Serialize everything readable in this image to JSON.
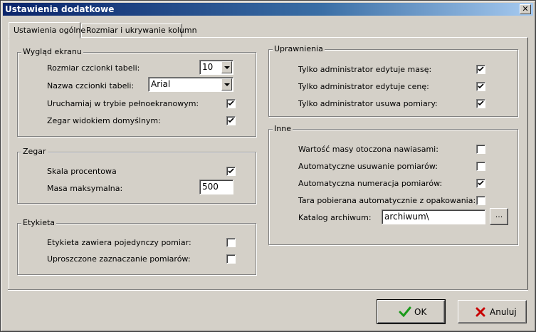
{
  "window": {
    "title": "Ustawienia dodatkowe",
    "close_glyph": "✕"
  },
  "tabs": [
    {
      "label": "Ustawienia ogólne",
      "active": true
    },
    {
      "label": "Rozmiar i ukrywanie kolumn",
      "active": false
    }
  ],
  "screen_group": {
    "title": "Wygląd ekranu",
    "font_size_label": "Rozmiar czcionki tabeli:",
    "font_size_value": "10",
    "font_name_label": "Nazwa czcionki tabeli:",
    "font_name_value": "Arial",
    "fullscreen_label": "Uruchamiaj w trybie pełnoekranowym:",
    "fullscreen_checked": true,
    "clock_default_label": "Zegar widokiem domyślnym:",
    "clock_default_checked": true
  },
  "clock_group": {
    "title": "Zegar",
    "percent_scale_label": "Skala procentowa",
    "percent_scale_checked": true,
    "max_mass_label": "Masa maksymalna:",
    "max_mass_value": "500"
  },
  "label_group": {
    "title": "Etykieta",
    "single_measure_label": "Etykieta zawiera pojedynczy pomiar:",
    "single_measure_checked": false,
    "simplified_selection_label": "Uproszczone zaznaczanie pomiarów:",
    "simplified_selection_checked": false
  },
  "permissions_group": {
    "title": "Uprawnienia",
    "admin_edit_mass_label": "Tylko administrator edytuje masę:",
    "admin_edit_mass_checked": true,
    "admin_edit_price_label": "Tylko administrator edytuje cenę:",
    "admin_edit_price_checked": true,
    "admin_delete_label": "Tylko administrator usuwa pomiary:",
    "admin_delete_checked": true
  },
  "other_group": {
    "title": "Inne",
    "mass_brackets_label": "Wartość masy otoczona nawiasami:",
    "mass_brackets_checked": false,
    "auto_delete_label": "Automatyczne usuwanie pomiarów:",
    "auto_delete_checked": false,
    "auto_numbering_label": "Automatyczna numeracja pomiarów:",
    "auto_numbering_checked": true,
    "auto_tare_label": "Tara pobierana automatycznie z opakowania:",
    "auto_tare_checked": false,
    "archive_label": "Katalog archiwum:",
    "archive_value": "archiwum\\",
    "browse_label": "..."
  },
  "buttons": {
    "ok_label": "OK",
    "cancel_label": "Anuluj"
  },
  "colors": {
    "titlebar": "#0a246a",
    "face": "#d4d0c8",
    "ok_icon": "#1a9a1a",
    "cancel_icon": "#c80000"
  }
}
